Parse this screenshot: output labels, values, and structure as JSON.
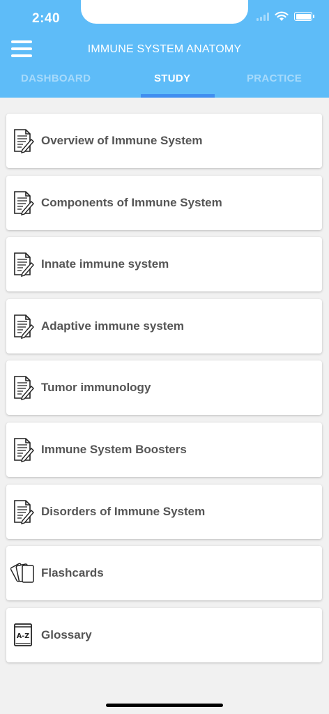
{
  "status_bar": {
    "time": "2:40"
  },
  "header": {
    "title": "IMMUNE SYSTEM ANATOMY"
  },
  "tabs": [
    {
      "label": "DASHBOARD",
      "active": false
    },
    {
      "label": "STUDY",
      "active": true
    },
    {
      "label": "PRACTICE",
      "active": false
    }
  ],
  "items": [
    {
      "label": "Overview of Immune System",
      "icon": "document-edit-icon"
    },
    {
      "label": "Components of Immune System",
      "icon": "document-edit-icon"
    },
    {
      "label": "Innate immune system",
      "icon": "document-edit-icon"
    },
    {
      "label": "Adaptive immune system",
      "icon": "document-edit-icon"
    },
    {
      "label": "Tumor immunology",
      "icon": "document-edit-icon"
    },
    {
      "label": "Immune System Boosters",
      "icon": "document-edit-icon"
    },
    {
      "label": "Disorders of Immune System",
      "icon": "document-edit-icon"
    },
    {
      "label": "Flashcards",
      "icon": "flashcards-icon"
    },
    {
      "label": "Glossary",
      "icon": "glossary-az-icon",
      "icon_text": "A-Z"
    }
  ],
  "colors": {
    "header": "#5ebcf8",
    "tab_indicator": "#3f8ef0",
    "background": "#f1f1f1"
  }
}
